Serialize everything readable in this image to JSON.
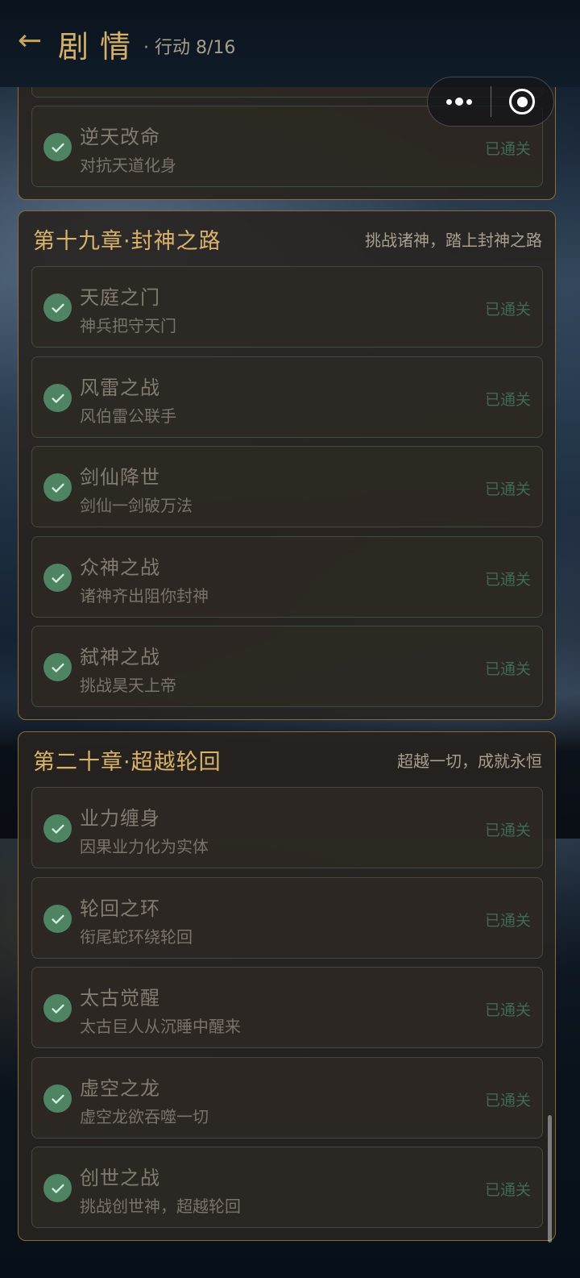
{
  "header": {
    "back_label": "←",
    "title": "剧情",
    "action_text": "· 行动 8/16"
  },
  "chapters": [
    {
      "title": "",
      "subtitle": "",
      "levels": [
        {
          "name": "逆天改命",
          "desc": "对抗天道化身",
          "status": "已通关"
        }
      ]
    },
    {
      "title": "第十九章·封神之路",
      "subtitle": "挑战诸神，踏上封神之路",
      "levels": [
        {
          "name": "天庭之门",
          "desc": "神兵把守天门",
          "status": "已通关"
        },
        {
          "name": "风雷之战",
          "desc": "风伯雷公联手",
          "status": "已通关"
        },
        {
          "name": "剑仙降世",
          "desc": "剑仙一剑破万法",
          "status": "已通关"
        },
        {
          "name": "众神之战",
          "desc": "诸神齐出阻你封神",
          "status": "已通关"
        },
        {
          "name": "弑神之战",
          "desc": "挑战昊天上帝",
          "status": "已通关"
        }
      ]
    },
    {
      "title": "第二十章·超越轮回",
      "subtitle": "超越一切，成就永恒",
      "levels": [
        {
          "name": "业力缠身",
          "desc": "因果业力化为实体",
          "status": "已通关"
        },
        {
          "name": "轮回之环",
          "desc": "衔尾蛇环绕轮回",
          "status": "已通关"
        },
        {
          "name": "太古觉醒",
          "desc": "太古巨人从沉睡中醒来",
          "status": "已通关"
        },
        {
          "name": "虚空之龙",
          "desc": "虚空龙欲吞噬一切",
          "status": "已通关"
        },
        {
          "name": "创世之战",
          "desc": "挑战创世神，超越轮回",
          "status": "已通关"
        }
      ]
    }
  ]
}
